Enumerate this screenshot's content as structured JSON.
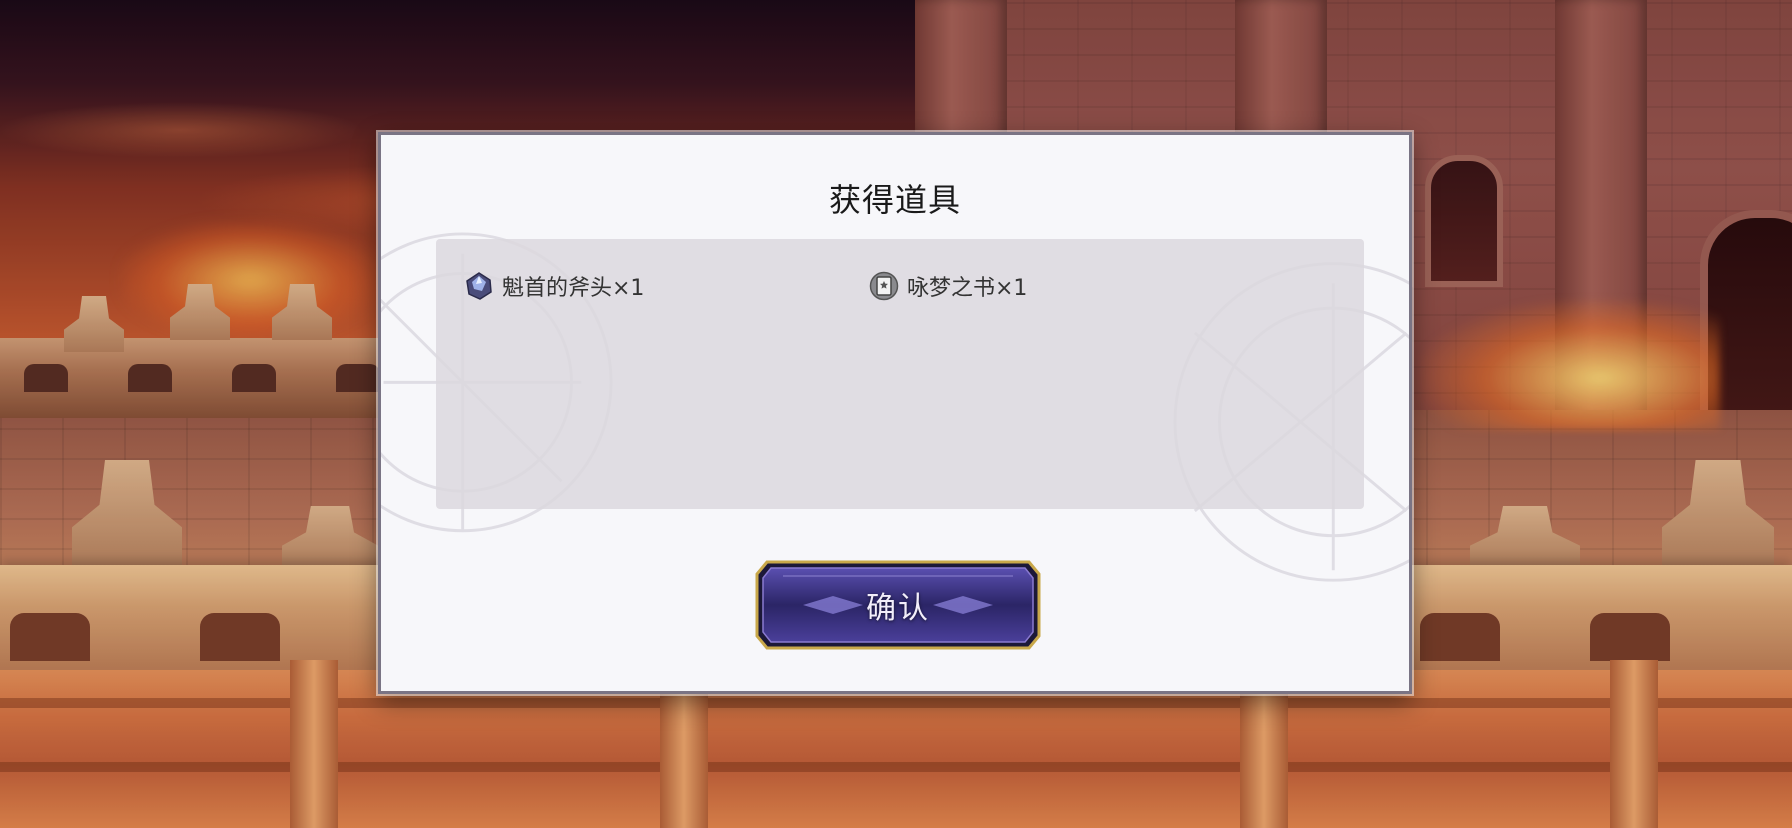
{
  "dialog": {
    "title": "获得道具",
    "items": [
      {
        "name": "魁首的斧头×1",
        "icon": "crystal-ore-icon"
      },
      {
        "name": "咏梦之书×1",
        "icon": "book-icon"
      }
    ],
    "confirm_label": "确认"
  },
  "colors": {
    "dialog_bg": "#f7f7fa",
    "panel_bg": "#dcd8de",
    "button_fill": "#2f2a6a",
    "button_border": "#c9a84a"
  }
}
